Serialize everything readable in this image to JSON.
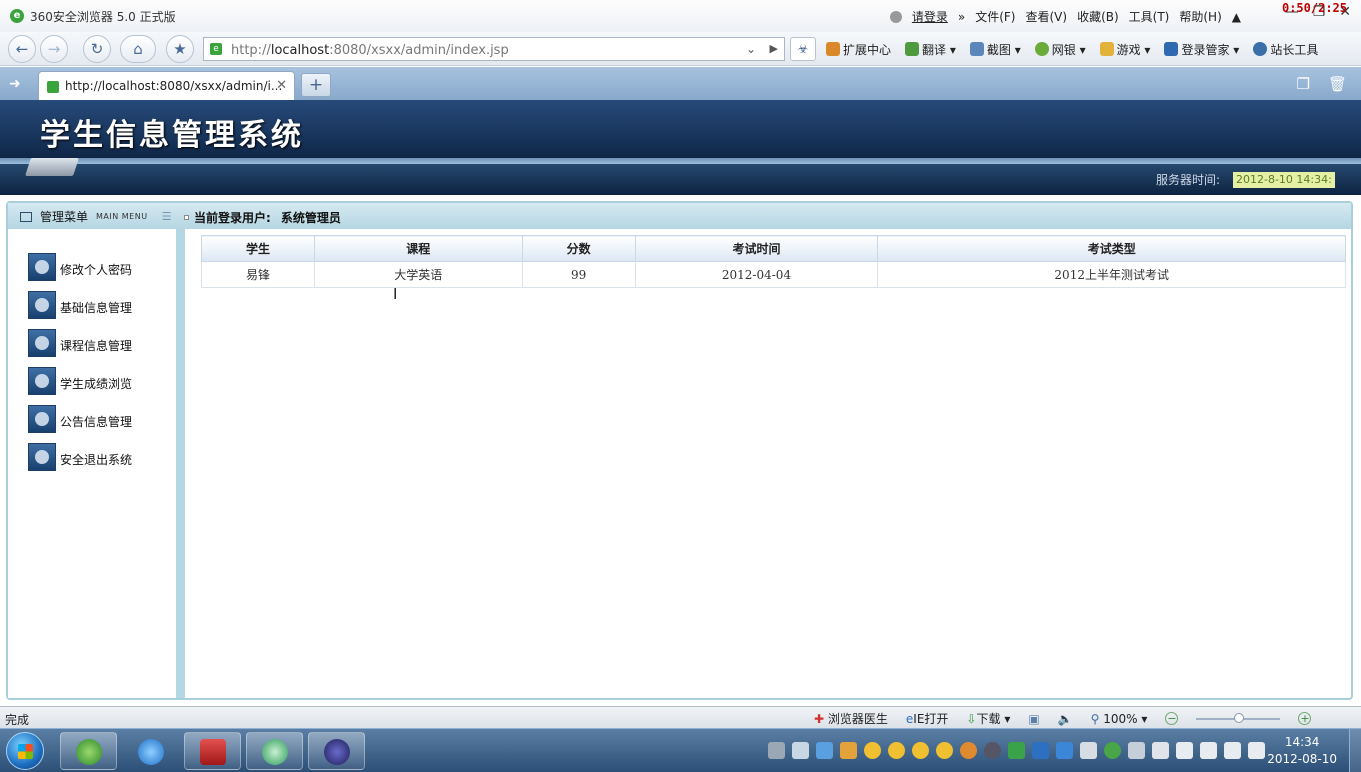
{
  "window": {
    "title": "360安全浏览器 5.0 正式版",
    "login_link": "请登录",
    "menus": [
      "文件(F)",
      "查看(V)",
      "收藏(B)",
      "工具(T)",
      "帮助(H)"
    ],
    "overlay_clock": "0:50/2:25"
  },
  "address_bar": {
    "url_prefix": "http://",
    "url_host": "localhost",
    "url_rest": ":8080/xsxx/admin/index.jsp"
  },
  "toolbar": {
    "items": [
      "扩展中心",
      "翻译",
      "截图",
      "网银",
      "游戏",
      "登录管家",
      "站长工具"
    ]
  },
  "tab": {
    "label": "http://localhost:8080/xsxx/admin/i..."
  },
  "header": {
    "system_title": "学生信息管理系统",
    "server_time_label": "服务器时间:",
    "server_time_value": "2012-8-10 14:34:"
  },
  "menu": {
    "title": "管理菜单",
    "title_en": "MAIN MENU",
    "current_user_label": "当前登录用户:",
    "current_user_value": "系统管理员",
    "items": [
      "修改个人密码",
      "基础信息管理",
      "课程信息管理",
      "学生成绩浏览",
      "公告信息管理",
      "安全退出系统"
    ]
  },
  "table": {
    "columns": [
      "学生",
      "课程",
      "分数",
      "考试时间",
      "考试类型"
    ],
    "rows": [
      [
        "易锋",
        "大学英语",
        "99",
        "2012-04-04",
        "2012上半年测试考试"
      ]
    ]
  },
  "statusbar": {
    "status": "完成",
    "doctor": "浏览器医生",
    "ie_open": "IE打开",
    "download": "下载",
    "zoom": "100%"
  },
  "taskbar": {
    "time": "14:34",
    "date": "2012-08-10"
  }
}
